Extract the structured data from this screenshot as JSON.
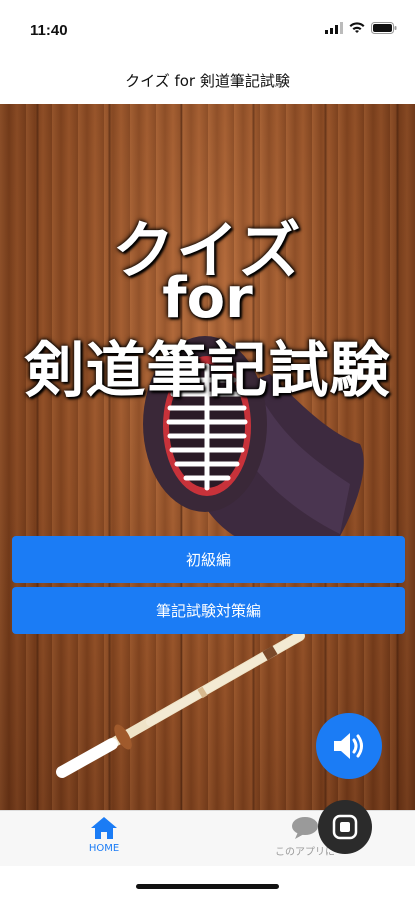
{
  "status_bar": {
    "time": "11:40"
  },
  "nav": {
    "title": "クイズ for 剣道筆記試験"
  },
  "hero": {
    "line1": "クイズ",
    "line2": "for",
    "line3": "剣道筆記試験"
  },
  "menu": {
    "beginner_label": "初級編",
    "exam_label": "筆記試験対策編"
  },
  "tabs": {
    "home_label": "HOME",
    "about_label": "このアプリに"
  },
  "icons": {
    "sound": "speaker-icon",
    "home": "home-icon",
    "about": "chat-bubble-icon",
    "float": "stop-icon"
  },
  "colors": {
    "accent": "#1b7cf5",
    "wood": "#8d4a22"
  }
}
